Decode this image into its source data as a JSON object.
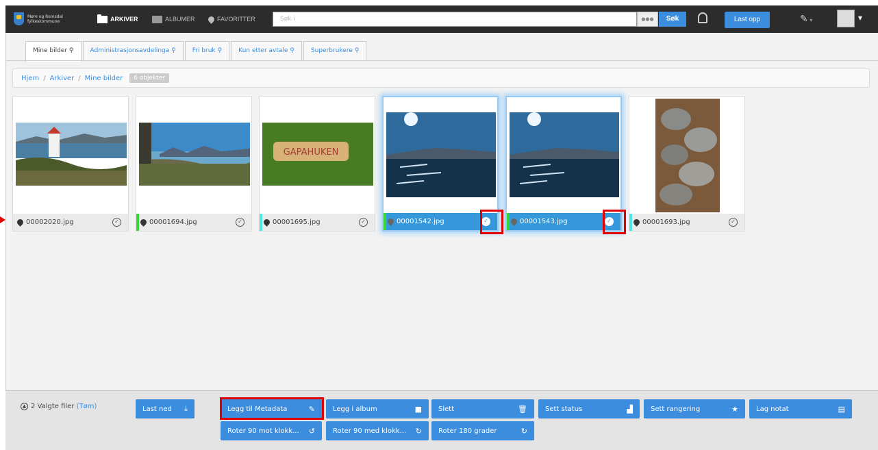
{
  "logo": {
    "text": "Møre og Romsdal fylkeskommune"
  },
  "nav": {
    "archives": "ARKIVER",
    "albums": "ALBUMER",
    "favorites": "FAVORITTER"
  },
  "search": {
    "placeholder": "Søk i",
    "more": "●●●",
    "button": "Søk"
  },
  "upload_label": "Last opp",
  "tabs": [
    "Mine bilder",
    "Administrasjonsavdelinga",
    "Fri bruk",
    "Kun etter avtale",
    "Superbrukere"
  ],
  "breadcrumb": {
    "items": [
      "Hjem",
      "Arkiver",
      "Mine bilder"
    ],
    "count": "6 objekter"
  },
  "images": [
    {
      "file": "00002020.jpg",
      "selected": false,
      "stripe": ""
    },
    {
      "file": "00001694.jpg",
      "selected": false,
      "stripe": "#39d639"
    },
    {
      "file": "00001695.jpg",
      "selected": false,
      "stripe": "#4fe8e8"
    },
    {
      "file": "00001542.jpg",
      "selected": true,
      "stripe": "#39d639"
    },
    {
      "file": "00001543.jpg",
      "selected": true,
      "stripe": "#39d639"
    },
    {
      "file": "00001693.jpg",
      "selected": false,
      "stripe": "#4fe8e8"
    }
  ],
  "selection": {
    "text": "2 Valgte filer",
    "clear": "(Tøm)"
  },
  "actions": {
    "download": "Last ned",
    "add_metadata": "Legg til Metadata",
    "add_album": "Legg i album",
    "delete": "Slett",
    "set_status": "Sett status",
    "set_rating": "Sett rangering",
    "make_note": "Lag notat",
    "rotate_ccw": "Roter 90 mot klokk...",
    "rotate_cw": "Roter 90 med klokk...",
    "rotate_180": "Roter 180 grader"
  },
  "colors": {
    "accent": "#3c8dde",
    "selected": "#3498db",
    "highlight": "#e00000"
  }
}
